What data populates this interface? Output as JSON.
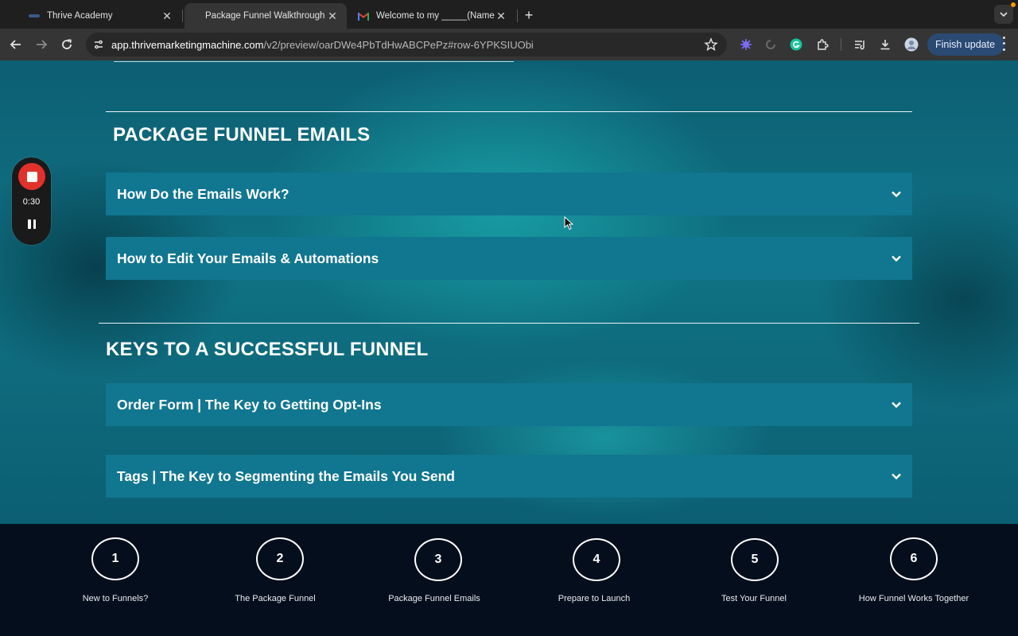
{
  "browser": {
    "tabs": [
      {
        "title": "Thrive Academy",
        "favicon": "thrive-favicon-icon",
        "active": false
      },
      {
        "title": "Package Funnel Walkthrough",
        "favicon": "none",
        "active": true
      },
      {
        "title": "Welcome to my _____(Name o",
        "favicon": "gmail-icon",
        "active": false
      }
    ],
    "url_host": "app.thrivemarketingmachine.com",
    "url_path": "/v2/preview/oarDWe4PbTdHwABCPePz#row-6YPKSIUObi",
    "finish_update_label": "Finish update",
    "accent_color": "#2b4a73"
  },
  "recorder": {
    "time": "0:30",
    "stop_color": "#e0322b"
  },
  "sections": [
    {
      "title": "PACKAGE FUNNEL EMAILS",
      "items": [
        {
          "label": "How Do the Emails Work?"
        },
        {
          "label": "How to Edit Your Emails & Automations"
        }
      ]
    },
    {
      "title": "KEYS TO A SUCCESSFUL FUNNEL",
      "items": [
        {
          "label": "Order Form | The Key to Getting Opt-Ins"
        },
        {
          "label": "Tags | The Key to Segmenting the Emails You Send"
        }
      ]
    }
  ],
  "steps": [
    {
      "number": "1",
      "label": "New to Funnels?"
    },
    {
      "number": "2",
      "label": "The Package Funnel"
    },
    {
      "number": "3",
      "label": "Package Funnel Emails"
    },
    {
      "number": "4",
      "label": "Prepare to Launch"
    },
    {
      "number": "5",
      "label": "Test Your Funnel"
    },
    {
      "number": "6",
      "label": "How Funnel Works Together"
    }
  ],
  "colors": {
    "accordion_bg": "#117690",
    "page_teal": "#0f7283",
    "steps_bar_bg": "#040e1c"
  }
}
